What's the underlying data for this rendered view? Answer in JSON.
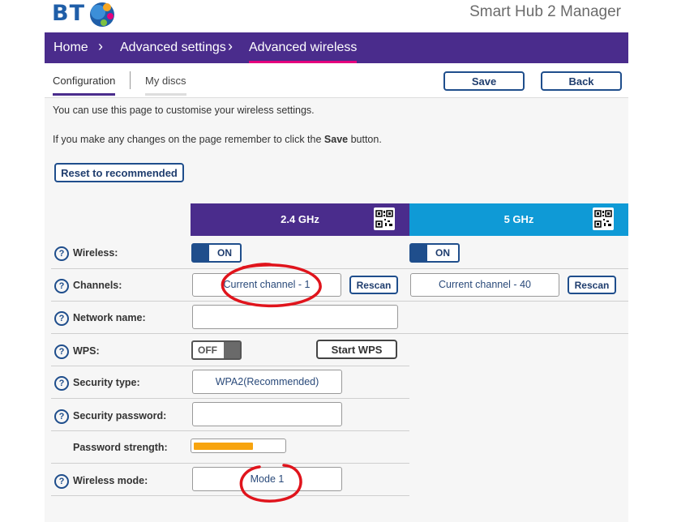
{
  "header": {
    "logo_text": "BT",
    "app_title": "Smart Hub 2 Manager"
  },
  "nav": {
    "home": "Home",
    "advanced_settings": "Advanced settings",
    "advanced_wireless": "Advanced wireless"
  },
  "tabs": {
    "configuration": "Configuration",
    "my_discs": "My discs"
  },
  "toolbar": {
    "save": "Save",
    "back": "Back"
  },
  "intro": {
    "line1": "You can use this page to customise your wireless settings.",
    "line2_prefix": "If you make any changes on the page remember to click the ",
    "line2_bold": "Save",
    "line2_suffix": " button."
  },
  "reset_button": "Reset to recommended",
  "bands": {
    "b24": {
      "label": "2.4 GHz",
      "color": "#4a2c8c"
    },
    "b5": {
      "label": "5 GHz",
      "color": "#0f9ad6"
    }
  },
  "settings": {
    "wireless_label": "Wireless:",
    "wireless_24_state": "ON",
    "wireless_5_state": "ON",
    "channels_label": "Channels:",
    "channel_24_value": "Current channel - 1",
    "channel_5_value": "Current channel - 40",
    "rescan": "Rescan",
    "network_name_label": "Network name:",
    "network_name_value": "",
    "wps_label": "WPS:",
    "wps_state": "OFF",
    "start_wps": "Start WPS",
    "security_type_label": "Security type:",
    "security_type_value": "WPA2(Recommended)",
    "security_password_label": "Security password:",
    "security_password_value": "",
    "password_strength_label": "Password strength:",
    "password_strength_fraction": 0.65,
    "wireless_mode_label": "Wireless mode:",
    "wireless_mode_value": "Mode 1"
  },
  "colors": {
    "brand_purple": "#4a2c8c",
    "accent_pink": "#e5007d",
    "band5_blue": "#0f9ad6",
    "strength_orange": "#f7a40f",
    "annotation_red": "#e0141c"
  }
}
